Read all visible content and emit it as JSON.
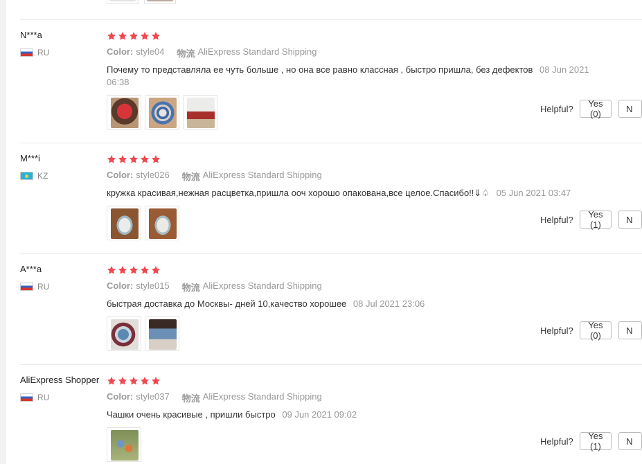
{
  "labels": {
    "color": "Color:",
    "logistics": "物流",
    "helpful": "Helpful?"
  },
  "reviews": [
    {
      "user": "N***a",
      "country": "RU",
      "stars": 5,
      "color": "style04",
      "shipping": "AliExpress Standard Shipping",
      "text": "Почему то представляла ее чуть больше , но она все равно классная , быстро пришла, без дефектов",
      "date": "08 Jun 2021 06:38",
      "yes": "Yes (0)",
      "no": "N"
    },
    {
      "user": "M***i",
      "country": "KZ",
      "stars": 5,
      "color": "style026",
      "shipping": "AliExpress Standard Shipping",
      "text": "кружка красивая,нежная расцветка,пришла ооч хорошо опакована,все целое.Спасибо!!⇓♤",
      "date": "05 Jun 2021 03:47",
      "yes": "Yes (1)",
      "no": "N"
    },
    {
      "user": "A***a",
      "country": "RU",
      "stars": 5,
      "color": "style015",
      "shipping": "AliExpress Standard Shipping",
      "text": "быстрая доставка до Москвы- дней 10,качество хорошее",
      "date": "08 Jul 2021 23:06",
      "yes": "Yes (0)",
      "no": "N"
    },
    {
      "user": "AliExpress Shopper",
      "country": "RU",
      "stars": 5,
      "color": "style037",
      "shipping": "AliExpress Standard Shipping",
      "text": "Чашки очень красивые , пришли быстро",
      "date": "09 Jun 2021 09:02",
      "yes": "Yes (1)",
      "no": "N"
    }
  ],
  "colors": {
    "star": "#f0484e",
    "muted": "#999999",
    "divider": "#e8e8e8"
  }
}
